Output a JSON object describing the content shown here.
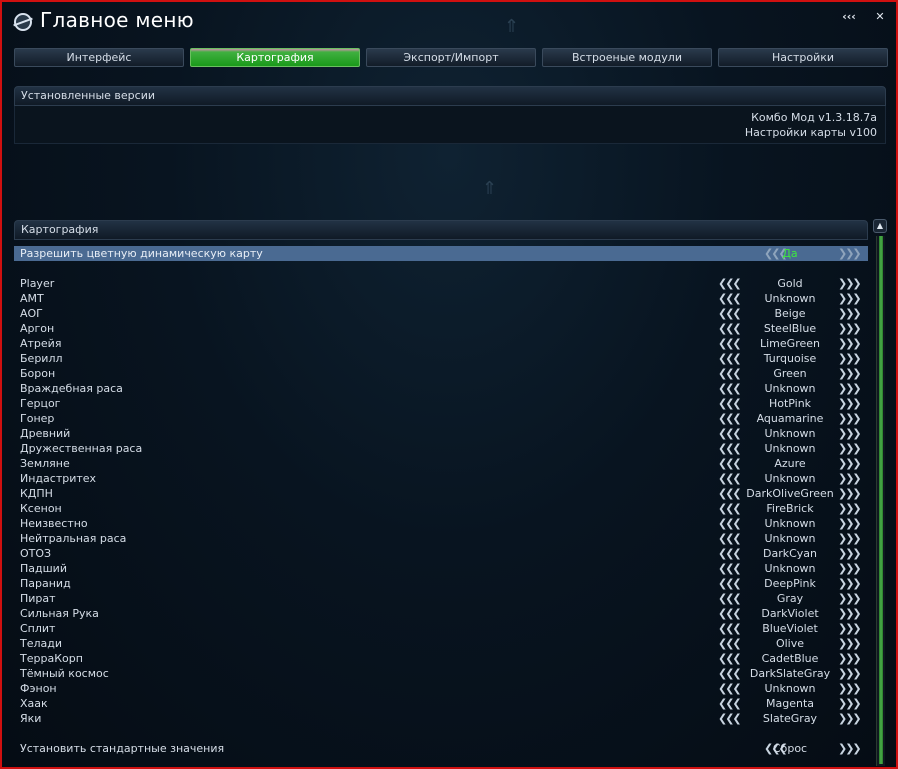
{
  "window": {
    "title": "Главное меню",
    "collapse_label": "‹‹‹",
    "close_label": "✕"
  },
  "tabs": [
    {
      "label": "Интерфейс",
      "active": false
    },
    {
      "label": "Картография",
      "active": true
    },
    {
      "label": "Экспорт/Импорт",
      "active": false
    },
    {
      "label": "Встроеные модули",
      "active": false
    },
    {
      "label": "Настройки",
      "active": false
    }
  ],
  "versions": {
    "header": "Установленные версии",
    "lines": [
      "Комбо Мод v1.3.18.7a",
      "Настройки карты v100"
    ]
  },
  "cartography": {
    "header": "Картография",
    "toggle": {
      "label": "Разрешить цветную динамическую карту",
      "value": "Да"
    },
    "arrow_left": "❮❮❮",
    "arrow_right": "❯❯❯",
    "rows": [
      {
        "label": "Player",
        "value": "Gold"
      },
      {
        "label": "АМТ",
        "value": "Unknown"
      },
      {
        "label": "АОГ",
        "value": "Beige"
      },
      {
        "label": "Аргон",
        "value": "SteelBlue"
      },
      {
        "label": "Атрейя",
        "value": "LimeGreen"
      },
      {
        "label": "Берилл",
        "value": "Turquoise"
      },
      {
        "label": "Борон",
        "value": "Green"
      },
      {
        "label": "Враждебная раса",
        "value": "Unknown"
      },
      {
        "label": "Герцог",
        "value": "HotPink"
      },
      {
        "label": "Гонер",
        "value": "Aquamarine"
      },
      {
        "label": "Древний",
        "value": "Unknown"
      },
      {
        "label": "Дружественная раса",
        "value": "Unknown"
      },
      {
        "label": "Земляне",
        "value": "Azure"
      },
      {
        "label": "Индастритех",
        "value": "Unknown"
      },
      {
        "label": "КДПН",
        "value": "DarkOliveGreen"
      },
      {
        "label": "Ксенон",
        "value": "FireBrick"
      },
      {
        "label": "Неизвестно",
        "value": "Unknown"
      },
      {
        "label": "Нейтральная раса",
        "value": "Unknown"
      },
      {
        "label": "ОТОЗ",
        "value": "DarkCyan"
      },
      {
        "label": "Падший",
        "value": "Unknown"
      },
      {
        "label": "Паранид",
        "value": "DeepPink"
      },
      {
        "label": "Пират",
        "value": "Gray"
      },
      {
        "label": "Сильная Рука",
        "value": "DarkViolet"
      },
      {
        "label": "Сплит",
        "value": "BlueViolet"
      },
      {
        "label": "Телади",
        "value": "Olive"
      },
      {
        "label": "ТерраКорп",
        "value": "CadetBlue"
      },
      {
        "label": "Тёмный космос",
        "value": "DarkSlateGray"
      },
      {
        "label": "Фэнон",
        "value": "Unknown"
      },
      {
        "label": "Хаак",
        "value": "Magenta"
      },
      {
        "label": "Яки",
        "value": "SlateGray"
      }
    ],
    "reset": {
      "label": "Установить стандартные значения",
      "value": "Сброс"
    }
  },
  "colors": {
    "frame_border": "#d01010",
    "active_tab": "#1a9a1a",
    "highlight_row": "#4a6a92",
    "toggle_value": "#3ee83e"
  },
  "icons": {
    "logo": "globe-logo-icon",
    "scroll_up": "scroll-up-icon"
  }
}
